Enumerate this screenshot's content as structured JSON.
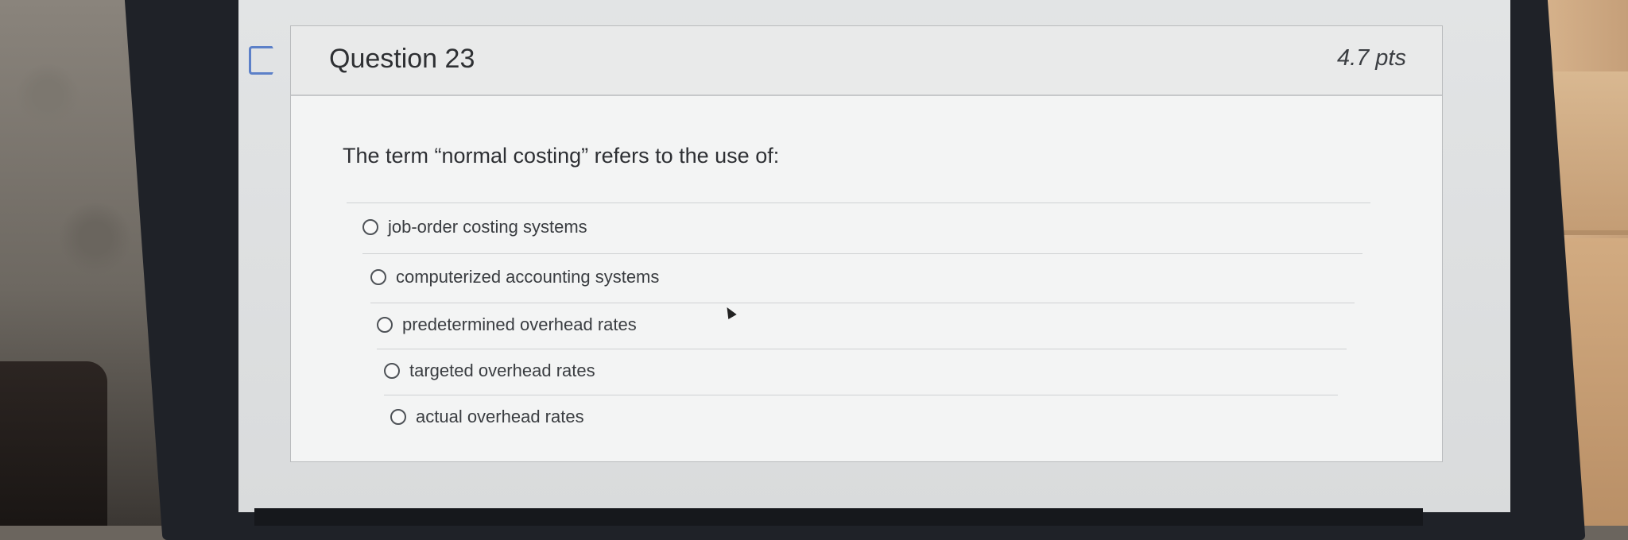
{
  "question": {
    "title": "Question 23",
    "points": "4.7 pts",
    "text": "The term “normal costing” refers to the use of:",
    "answers": [
      {
        "label": "job-order costing systems",
        "selected": false
      },
      {
        "label": "computerized accounting systems",
        "selected": false
      },
      {
        "label": "predetermined overhead rates",
        "selected": false
      },
      {
        "label": "targeted overhead rates",
        "selected": false
      },
      {
        "label": "actual overhead rates",
        "selected": false
      }
    ]
  },
  "colors": {
    "flag_outline": "#5c80c8",
    "card_background": "#f3f4f4",
    "text": "#2e3033"
  },
  "icons": {
    "flag": "bookmark-flag-icon",
    "cursor": "mouse-pointer-icon"
  }
}
